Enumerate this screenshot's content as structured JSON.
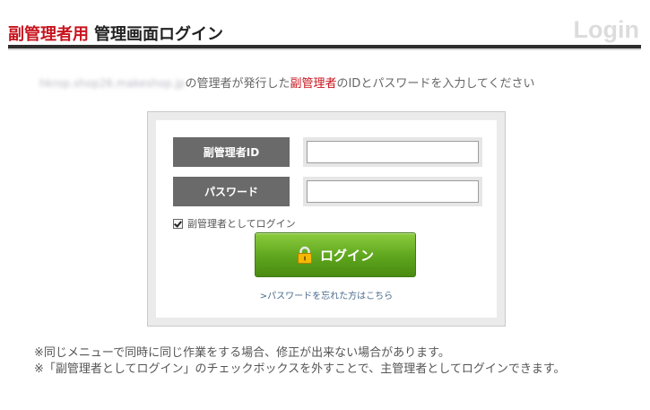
{
  "header": {
    "title_red": "副管理者用",
    "title_black": "管理画面ログイン",
    "login_word": "Login"
  },
  "intro": {
    "blurred_domain": "hkrop.shop26.makeshop.jp",
    "text_before": "の管理者が発行した",
    "text_red": "副管理者",
    "text_after": "のIDとパスワードを入力してください"
  },
  "form": {
    "id_label": "副管理者ID",
    "id_value": "",
    "password_label": "パスワード",
    "password_value": "",
    "checkbox_label": "副管理者としてログイン",
    "checkbox_checked": true,
    "login_button_label": "ログイン",
    "forgot_link": ">パスワードを忘れた方はこちら"
  },
  "notes": [
    "※同じメニューで同時に同じ作業をする場合、修正が出来ない場合があります。",
    "※「副管理者としてログイン」のチェックボックスを外すことで、主管理者としてログインできます。"
  ],
  "colors": {
    "accent_red": "#c8141e",
    "button_green": "#5ea51d",
    "label_gray": "#6a6a6a"
  },
  "icons": {
    "login_button_icon": "lock-icon"
  }
}
